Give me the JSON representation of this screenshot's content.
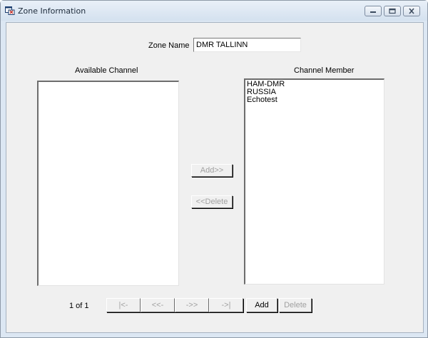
{
  "window": {
    "title": "Zone Information",
    "minimize_icon": "minimize-icon",
    "maximize_icon": "maximize-icon",
    "close_icon": "close-icon"
  },
  "zone": {
    "name_label": "Zone Name",
    "name_value": "DMR TALLINN"
  },
  "available_channel": {
    "header": "Available Channel",
    "items": []
  },
  "channel_member": {
    "header": "Channel Member",
    "items": [
      "HAM-DMR",
      "RUSSIA",
      "Echotest"
    ]
  },
  "transfer": {
    "add_label": "Add>>",
    "delete_label": "<<Delete"
  },
  "pager": {
    "page_text": "1 of 1",
    "first_label": "|<-",
    "prev_label": "<<-",
    "next_label": "->>",
    "last_label": "->|",
    "add_label": "Add",
    "delete_label": "Delete"
  }
}
